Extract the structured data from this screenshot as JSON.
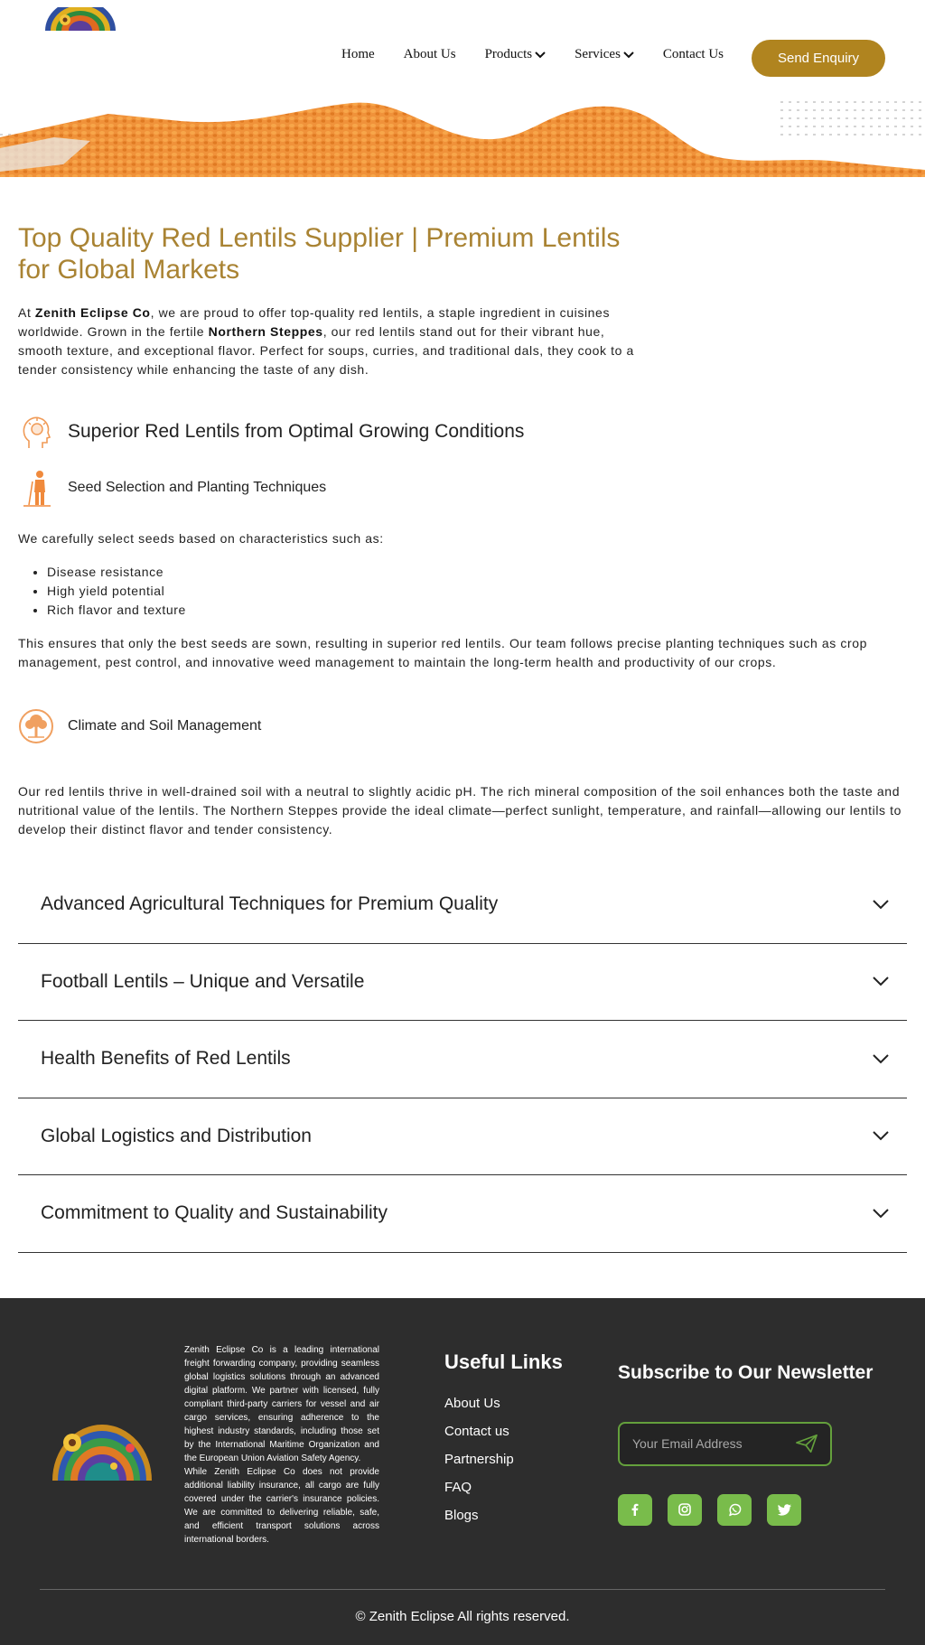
{
  "nav": {
    "items": [
      {
        "label": "Home",
        "dropdown": false
      },
      {
        "label": "About Us",
        "dropdown": false
      },
      {
        "label": "Products",
        "dropdown": true
      },
      {
        "label": "Services",
        "dropdown": true
      },
      {
        "label": "Contact Us",
        "dropdown": false
      }
    ],
    "cta_label": "Send Enquiry"
  },
  "main": {
    "title": "Top Quality Red Lentils Supplier | Premium Lentils for Global Markets",
    "intro": {
      "p1": "At ",
      "company": "Zenith Eclipse Co",
      "p2": ", we are proud to offer top-quality red lentils, a staple ingredient in cuisines worldwide. Grown in the fertile ",
      "region": "Northern Steppes",
      "p3": ", our red lentils stand out for their vibrant hue, smooth texture, and exceptional flavor. Perfect for soups, curries, and traditional dals, they cook to a tender consistency while enhancing the taste of any dish."
    },
    "superior_heading": "Superior Red Lentils from Optimal Growing Conditions",
    "seed_heading": "Seed Selection and Planting Techniques",
    "seed_intro": "We carefully select seeds based on characteristics such as:",
    "seed_bullets": [
      "Disease resistance",
      "High yield potential",
      "Rich flavor and texture"
    ],
    "seed_outro": "This ensures that only the best seeds are sown, resulting in superior red lentils. Our team follows precise planting techniques such as crop management, pest control, and innovative weed management to maintain the long-term health and productivity of our crops.",
    "climate_heading": "Climate and Soil Management",
    "climate_text": "Our red lentils thrive in well-drained soil with a neutral to slightly acidic pH. The rich mineral composition of the soil enhances both the taste and nutritional value of the lentils. The Northern Steppes provide the ideal climate—perfect sunlight, temperature, and rainfall—allowing our lentils to develop their distinct flavor and tender consistency.",
    "accordion": [
      "Advanced Agricultural Techniques for Premium Quality",
      "Football Lentils – Unique and Versatile",
      "Health Benefits of Red Lentils",
      "Global Logistics and Distribution",
      "Commitment to Quality and Sustainability"
    ]
  },
  "footer": {
    "about_p1": "Zenith Eclipse Co is a leading international freight forwarding company, providing seamless global logistics solutions through an advanced digital platform. We partner with licensed, fully compliant third-party carriers for vessel and air cargo services, ensuring adherence to the highest industry standards, including those set by the International Maritime Organization and the European Union Aviation Safety Agency.",
    "about_p2": "While Zenith Eclipse Co does not provide additional liability insurance, all cargo are fully covered under the carrier's insurance policies. We are committed to delivering reliable, safe, and efficient transport solutions across international borders.",
    "useful_title": "Useful Links",
    "useful_links": [
      "About Us",
      "Contact us",
      "Partnership",
      "FAQ",
      "Blogs"
    ],
    "newsletter_title": "Subscribe to Our Newsletter",
    "email_placeholder": "Your Email Address",
    "socials": [
      "facebook-icon",
      "instagram-icon",
      "whatsapp-icon",
      "twitter-icon"
    ],
    "copyright": "© Zenith Eclipse All rights reserved."
  },
  "colors": {
    "accent_gold": "#b0841f",
    "title_gold": "#a98333",
    "lentil_orange": "#f29a3a",
    "footer_bg": "#2d2d2d",
    "social_green": "#79bc4b"
  }
}
